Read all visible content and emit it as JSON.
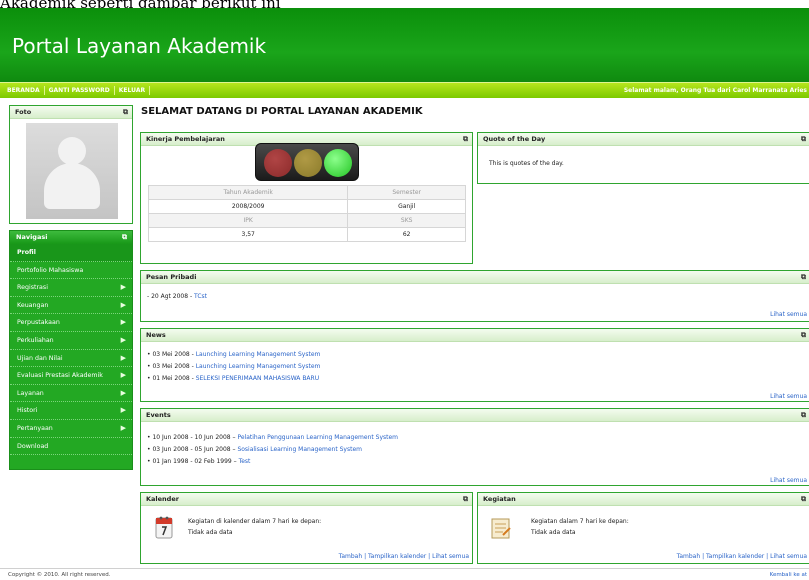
{
  "caption": "Akademik seperti gambar berikut ini",
  "header": {
    "title": "Portal Layanan Akademik"
  },
  "topmenu": {
    "items": [
      "BERANDA",
      "GANTI PASSWORD",
      "KELUAR"
    ],
    "greeting": "Selamat malam, Orang Tua dari Carol Marranata Aries"
  },
  "sidebar": {
    "foto_title": "Foto",
    "nav_title": "Navigasi",
    "items": [
      {
        "label": "Profil",
        "arrow": false
      },
      {
        "label": "Portofolio Mahasiswa",
        "arrow": false
      },
      {
        "label": "Registrasi",
        "arrow": true
      },
      {
        "label": "Keuangan",
        "arrow": true
      },
      {
        "label": "Perpustakaan",
        "arrow": true
      },
      {
        "label": "Perkuliahan",
        "arrow": true
      },
      {
        "label": "Ujian dan Nilai",
        "arrow": true
      },
      {
        "label": "Evaluasi Prestasi Akademik",
        "arrow": true
      },
      {
        "label": "Layanan",
        "arrow": true
      },
      {
        "label": "Histori",
        "arrow": true
      },
      {
        "label": "Pertanyaan",
        "arrow": true
      },
      {
        "label": "Download",
        "arrow": false
      }
    ]
  },
  "main": {
    "title": "SELAMAT DATANG DI PORTAL LAYANAN AKADEMIK"
  },
  "kinerja": {
    "title": "Kinerja Pembelajaran",
    "lamp_colors": {
      "red": "#8b2a2a",
      "yellow": "#8a7a2a",
      "green": "#22c422"
    },
    "labels_1": [
      "Tahun Akademik",
      "Semester"
    ],
    "values_1": [
      "2008/2009",
      "Ganjil"
    ],
    "labels_2": [
      "IPK",
      "SKS"
    ],
    "values_2": [
      "3,57",
      "62"
    ]
  },
  "quote": {
    "title": "Quote of the Day",
    "text": "This is quotes of the day."
  },
  "pesan": {
    "title": "Pesan Pribadi",
    "items": [
      {
        "date": "- 20 Agt 2008 - ",
        "text": "TCst"
      }
    ],
    "more": "Lihat semua"
  },
  "news": {
    "title": "News",
    "items": [
      {
        "date": "• 03 Mei 2008 - ",
        "text": "Launching Learning Management System"
      },
      {
        "date": "• 03 Mei 2008 - ",
        "text": "Launching Learning Management System"
      },
      {
        "date": "• 01 Mei 2008 - ",
        "text": "SELEKSI PENERIMAAN MAHASISWA BARU"
      }
    ],
    "more": "Lihat semua"
  },
  "events": {
    "title": "Events",
    "items": [
      {
        "date": "• 10 Jun 2008 - 10 Jun 2008 – ",
        "text": "Pelatihan Penggunaan Learning Management System"
      },
      {
        "date": "• 03 Jun 2008 - 05 Jun 2008 – ",
        "text": "Sosialisasi Learning Management System"
      },
      {
        "date": "• 01 Jan 1998 - 02 Feb 1999 – ",
        "text": "Test"
      }
    ],
    "more": "Lihat semua"
  },
  "kalender": {
    "title": "Kalender",
    "line1": "Kegiatan di kalender dalam 7 hari ke depan:",
    "line2": "Tidak ada data",
    "links": [
      "Tambah",
      "Tampilkan kalender",
      "Lihat semua"
    ]
  },
  "kegiatan": {
    "title": "Kegiatan",
    "line1": "Kegiatan dalam 7 hari ke depan:",
    "line2": "Tidak ada data",
    "links": [
      "Tambah",
      "Tampilkan kalender",
      "Lihat semua"
    ]
  },
  "footer": {
    "copyright": "Copyright © 2010. All right reserved.",
    "back": "Kembali ke at"
  }
}
